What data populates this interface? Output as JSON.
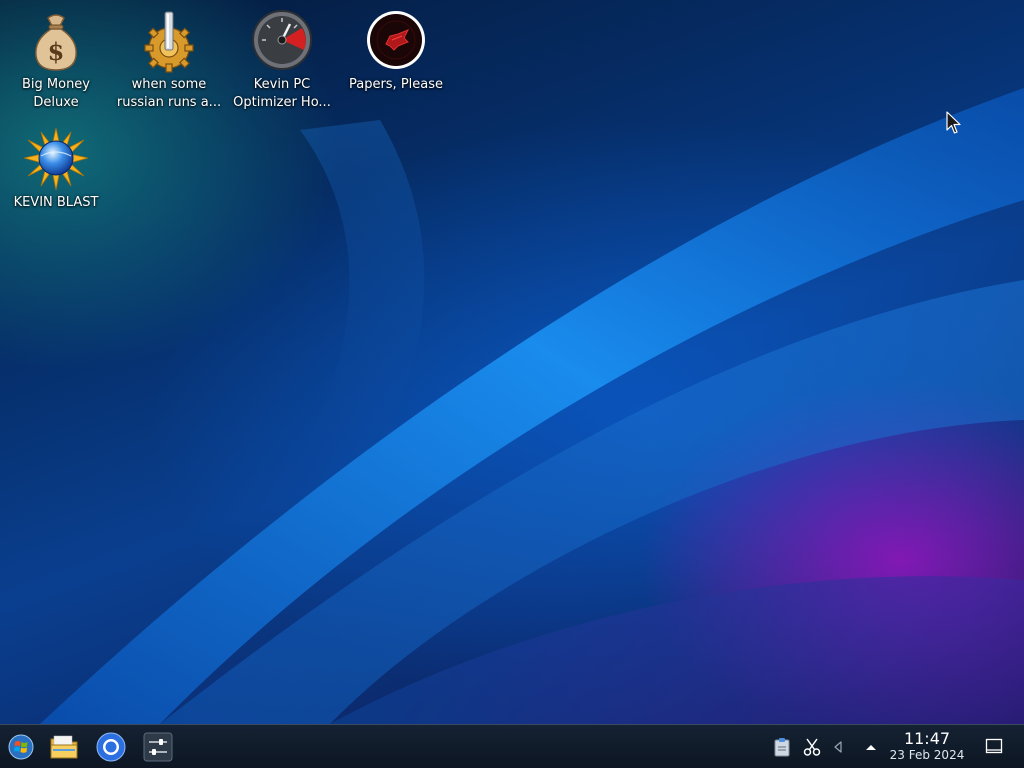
{
  "desktop": {
    "icons": [
      {
        "label": "Big Money\nDeluxe",
        "icon": "money-bag-icon"
      },
      {
        "label": "when some\nrussian runs a...",
        "icon": "gear-icon"
      },
      {
        "label": "Kevin PC\nOptimizer Ho...",
        "icon": "speedometer-icon"
      },
      {
        "label": "Papers, Please",
        "icon": "papers-please-icon"
      },
      {
        "label": "KEVIN BLAST",
        "icon": "sun-globe-icon"
      }
    ]
  },
  "taskbar": {
    "launchers": [
      {
        "icon": "start-menu-icon"
      },
      {
        "icon": "file-manager-folder-icon"
      },
      {
        "icon": "browser-icon"
      },
      {
        "icon": "settings-sliders-icon"
      }
    ],
    "tray": [
      {
        "icon": "clipboard-icon"
      },
      {
        "icon": "scissors-icon"
      },
      {
        "icon": "volume-icon"
      },
      {
        "icon": "expand-arrow-icon"
      }
    ],
    "clock": {
      "time": "11:47",
      "date": "23 Feb 2024"
    },
    "show_desktop": {
      "icon": "show-desktop-icon"
    }
  },
  "colors": {
    "taskbar_bg": "#131e2c",
    "wallpaper_blue": "#0a3f8f",
    "wallpaper_purple": "#9614be",
    "wallpaper_teal": "#148282"
  }
}
